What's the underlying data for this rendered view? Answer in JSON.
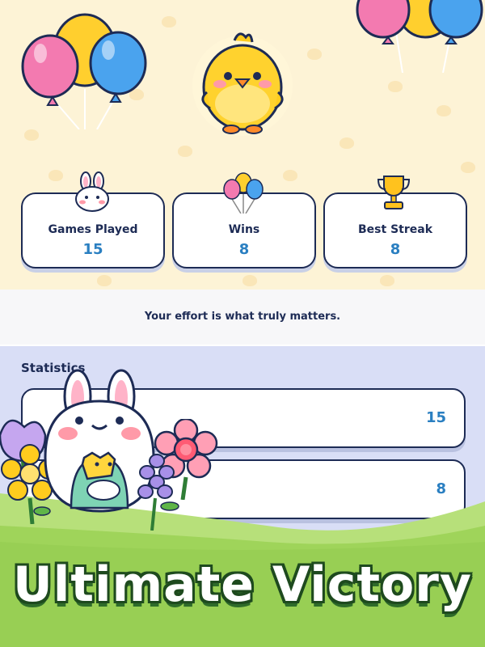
{
  "stats": [
    {
      "label": "Games Played",
      "value": "15",
      "icon": "bunny-icon"
    },
    {
      "label": "Wins",
      "value": "8",
      "icon": "balloons-icon"
    },
    {
      "label": "Best Streak",
      "value": "8",
      "icon": "trophy-icon"
    }
  ],
  "message": "Your effort is what truly matters.",
  "statistics": {
    "title": "Statistics",
    "rows": [
      {
        "value": "15"
      },
      {
        "value": "8"
      }
    ]
  },
  "banner": {
    "title": "Ultimate Victory"
  },
  "colors": {
    "navy": "#1d2b55",
    "value_blue": "#2a7fc1",
    "cream": "#fdf3d6",
    "lavender": "#d9def6",
    "grass": "#9fd45a"
  }
}
